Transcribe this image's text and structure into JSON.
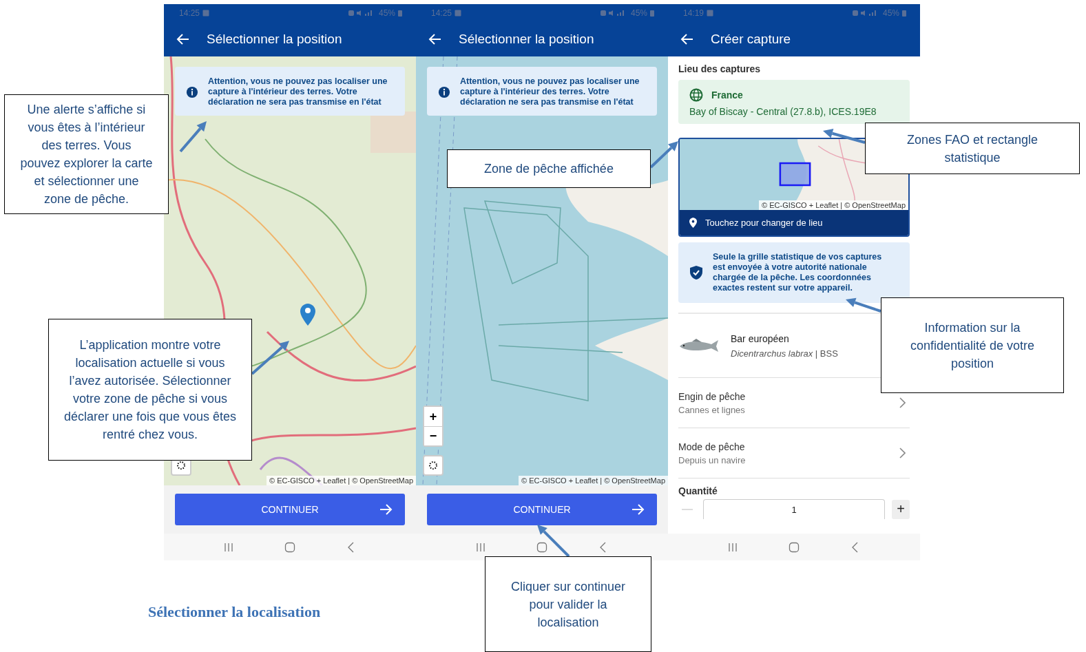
{
  "screens": [
    {
      "kind": "map",
      "status_bar": {
        "time": "14:25",
        "battery": "45%"
      },
      "app_bar": {
        "title": "Sélectionner la position"
      },
      "alert": "Attention, vous ne pouvez pas localiser une capture à l'intérieur des terres. Votre déclaration ne sera pas transmise en l'état",
      "map": {
        "kind": "land",
        "location_pin": true,
        "attribution": "© EC-GISCO + Leaflet | © OpenStreetMap"
      },
      "continue_button": "CONTINUER"
    },
    {
      "kind": "map",
      "status_bar": {
        "time": "14:25",
        "battery": "45%"
      },
      "app_bar": {
        "title": "Sélectionner la position"
      },
      "alert": "Attention, vous ne pouvez pas localiser une capture à l'intérieur des terres. Votre déclaration ne sera pas transmise en l'état",
      "map": {
        "kind": "sea",
        "location_pin": false,
        "zoom_buttons": [
          "+",
          "−"
        ],
        "attribution": "© EC-GISCO + Leaflet | © OpenStreetMap"
      },
      "continue_button": "CONTINUER"
    },
    {
      "kind": "form",
      "status_bar": {
        "time": "14:19",
        "battery": "45%"
      },
      "app_bar": {
        "title": "Créer capture"
      },
      "form": {
        "section_title": "Lieu des captures",
        "location": {
          "country": "France",
          "area": "Bay of Biscay - Central (27.8.b), ICES.19E8"
        },
        "map_attribution": "© EC-GISCO + Leaflet | © OpenStreetMap",
        "map_action": "Touchez pour changer de lieu",
        "privacy_note": "Seule la grille statistique de vos captures est envoyée à votre autorité nationale chargée de la pêche. Les coordonnées exactes restent sur votre appareil.",
        "species": {
          "name": "Bar européen",
          "detail": "*Dicentrarchus labrax* | BSS"
        },
        "fields": [
          {
            "label": "Engin de pêche",
            "value": "Cannes et lignes"
          },
          {
            "label": "Mode de pêche",
            "value": "Depuis un navire"
          }
        ],
        "quantity": {
          "label": "Quantité",
          "value": "1",
          "increment": "+"
        }
      }
    }
  ],
  "callouts": [
    {
      "text": "Une alerte s’affiche si vous êtes à l’intérieur des terres. Vous pouvez explorer la carte et sélectionner une zone de pêche."
    },
    {
      "text": "L’application montre votre localisation actuelle si vous l’avez autorisée. Sélectionner votre zone de pêche si vous déclarer une fois que vous êtes rentré chez vous."
    },
    {
      "text": "Zone de pêche affichée"
    },
    {
      "text": "Zones FAO et rectangle statistique"
    },
    {
      "text": "Information sur la confidentialité de votre position"
    },
    {
      "text": "Cliquer sur continuer pour valider la localisation"
    }
  ],
  "caption": "Sélectionner la localisation"
}
